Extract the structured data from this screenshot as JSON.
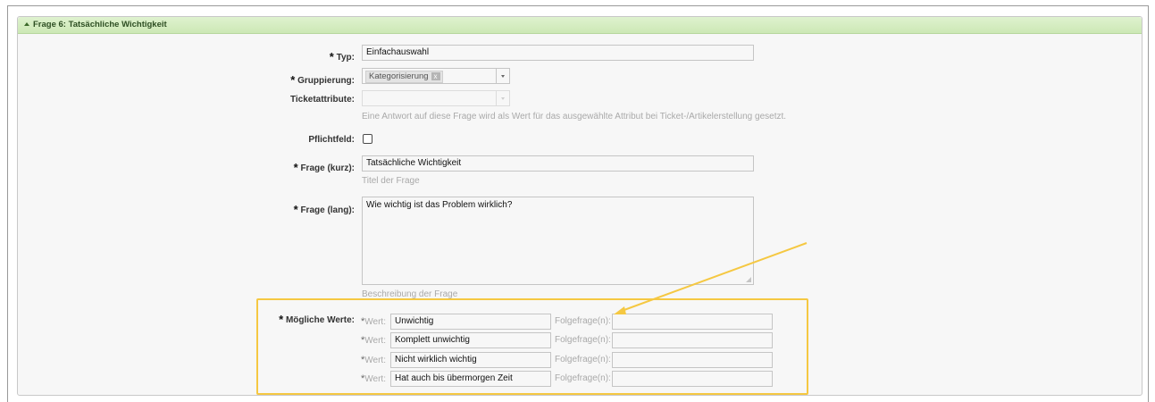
{
  "section": {
    "title": "Frage 6:  Tatsächliche Wichtigkeit"
  },
  "fields": {
    "typ": {
      "label": "Typ:",
      "value": "Einfachauswahl"
    },
    "gruppierung": {
      "label": "Gruppierung:",
      "token": "Kategorisierung",
      "remove": "x"
    },
    "ticketattribute": {
      "label": "Ticketattribute:",
      "hint": "Eine Antwort auf diese Frage wird als Wert für das ausgewählte Attribut bei Ticket-/Artikelerstellung gesetzt."
    },
    "pflichtfeld": {
      "label": "Pflichtfeld:",
      "checked": false
    },
    "frage_kurz": {
      "label": "Frage (kurz):",
      "value": "Tatsächliche Wichtigkeit",
      "hint": "Titel der Frage"
    },
    "frage_lang": {
      "label": "Frage (lang):",
      "value": "Wie wichtig ist das Problem wirklich?",
      "hint": "Beschreibung der Frage"
    },
    "moegliche_werte": {
      "label": "Mögliche Werte:",
      "value_label": "Wert:",
      "followup_label": "Folgefrage(n):",
      "rows": [
        {
          "value": "Unwichtig",
          "followup": ""
        },
        {
          "value": "Komplett unwichtig",
          "followup": ""
        },
        {
          "value": "Nicht wirklich wichtig",
          "followup": ""
        },
        {
          "value": "Hat auch bis übermorgen Zeit",
          "followup": ""
        }
      ]
    }
  },
  "required_mark": "*",
  "colors": {
    "header_bg": "#d6edc4",
    "highlight": "#f5c842",
    "hint": "#a9a9a9"
  }
}
